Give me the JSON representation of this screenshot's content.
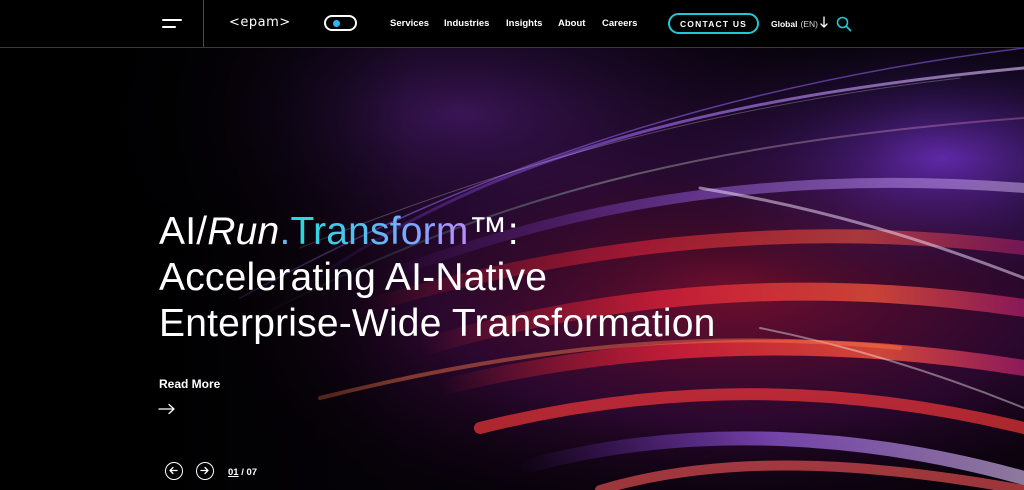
{
  "header": {
    "logo": "<epam>",
    "nav": [
      {
        "label": "Services"
      },
      {
        "label": "Industries"
      },
      {
        "label": "Insights"
      },
      {
        "label": "About"
      },
      {
        "label": "Careers"
      }
    ],
    "contact_label": "CONTACT US",
    "region_label": "Global",
    "region_code": "(EN)"
  },
  "hero": {
    "headline_part1": "AI/",
    "headline_run": "Run",
    "headline_dot": ".",
    "headline_transform": "Transform",
    "headline_tm": "™:",
    "headline_line2": "Accelerating AI-Native",
    "headline_line3": "Enterprise-Wide Transformation",
    "read_more": "Read More",
    "slide_current": "01",
    "slide_separator": " / ",
    "slide_total": "07"
  },
  "colors": {
    "accent": "#1fc9d4",
    "toggle_knob": "#29b6f6",
    "background": "#000000"
  },
  "icons": [
    "hamburger-menu-icon",
    "theme-toggle",
    "arrow-down-icon",
    "search-icon",
    "arrow-right-icon",
    "prev-slide-icon",
    "next-slide-icon"
  ]
}
